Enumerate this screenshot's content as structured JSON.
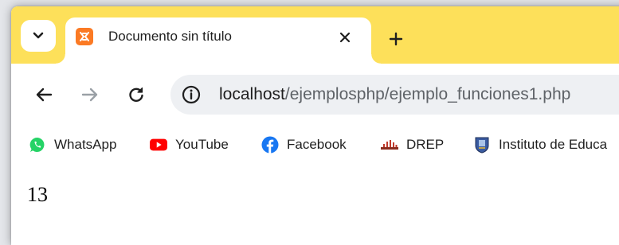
{
  "tabstrip": {
    "tab": {
      "title": "Documento sin título",
      "favicon": "xampp-icon"
    },
    "menu_icon": "chevron-down-icon",
    "close_icon": "close-icon",
    "new_tab_icon": "plus-icon"
  },
  "toolbar": {
    "back_icon": "arrow-left-icon",
    "forward_icon": "arrow-right-icon",
    "reload_icon": "reload-icon",
    "site_info_icon": "info-icon",
    "url_host": "localhost",
    "url_path": "/ejemplosphp/ejemplo_funciones1.php"
  },
  "bookmarks": [
    {
      "label": "WhatsApp",
      "icon": "whatsapp-icon",
      "color": "#25d366"
    },
    {
      "label": "YouTube",
      "icon": "youtube-icon",
      "color": "#ff0000"
    },
    {
      "label": "Facebook",
      "icon": "facebook-icon",
      "color": "#1877f2"
    },
    {
      "label": "DREP",
      "icon": "drep-icon",
      "color": "#c0392b"
    },
    {
      "label": "Instituto de Educa",
      "icon": "institute-icon",
      "color": "#3a5ba0"
    }
  ],
  "page": {
    "output": "13"
  },
  "colors": {
    "tabstrip": "#fde05a",
    "omnibox": "#eef0f3",
    "text": "#1f1f1f"
  }
}
